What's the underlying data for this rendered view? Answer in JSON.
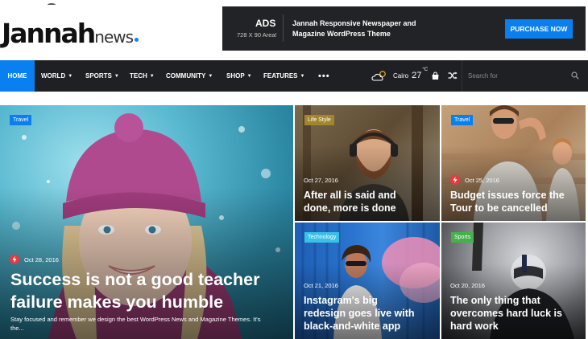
{
  "logo": {
    "main": "Jannah",
    "sub": "news"
  },
  "ad": {
    "title": "ADS",
    "size": "728 X 90 Area!",
    "text": "Jannah Responsive Newspaper and Magazine WordPress Theme",
    "button": "PURCHASE NOW"
  },
  "nav": {
    "items": [
      {
        "label": "HOME"
      },
      {
        "label": "WORLD"
      },
      {
        "label": "SPORTS"
      },
      {
        "label": "TECH"
      },
      {
        "label": "COMMUNITY"
      },
      {
        "label": "SHOP"
      },
      {
        "label": "FEATURES"
      }
    ],
    "more": "•••",
    "weather": {
      "city": "Cairo",
      "temp": "27",
      "unit": "°C",
      "icon": "cloud-sun-icon"
    },
    "search_placeholder": "Search for"
  },
  "posts": [
    {
      "category": "Travel",
      "category_color": "#0a7ff0",
      "date": "Oct 28, 2016",
      "title_line1": "Success is not a good teacher",
      "title_line2": "failure makes you humble",
      "excerpt_line1": "Stay focused and remember we design the best WordPress News and Magazine Themes. It's",
      "excerpt_line2": "the..."
    },
    {
      "category": "Life Style",
      "category_color": "#a1872a",
      "date": "Oct 27, 2016",
      "title_line1": "After all is said and",
      "title_line2": "done, more is done"
    },
    {
      "category": "Travel",
      "category_color": "#0a7ff0",
      "date": "Oct 25, 2016",
      "title_line1": "Budget issues force the",
      "title_line2": "Tour to be cancelled"
    },
    {
      "category": "Technology",
      "category_color": "#39c1e5",
      "date": "Oct 21, 2016",
      "title_line1": "Instagram's big",
      "title_line2": "redesign goes live with",
      "title_line3": "black-and-white app"
    },
    {
      "category": "Sports",
      "category_color": "#44b24a",
      "date": "Oct 20, 2016",
      "title_line1": "The only thing that",
      "title_line2": "overcomes hard luck is",
      "title_line3": "hard work"
    }
  ]
}
